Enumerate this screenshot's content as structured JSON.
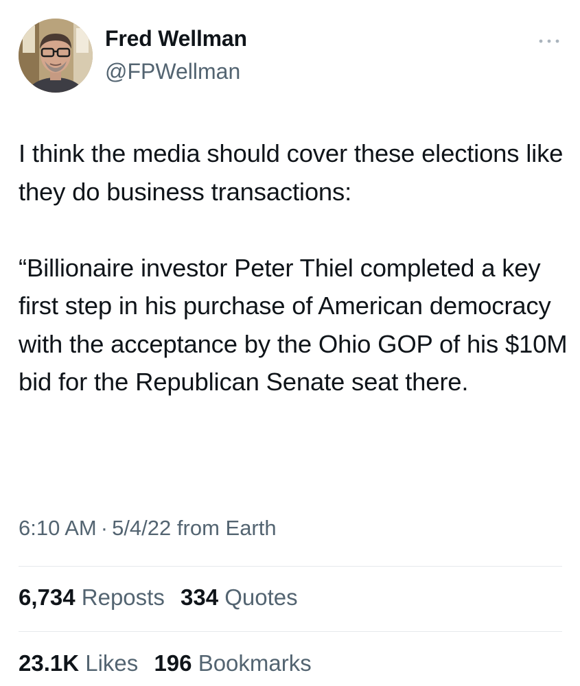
{
  "author": {
    "display_name": "Fred Wellman",
    "handle": "@FPWellman",
    "avatar_icon": "profile-photo"
  },
  "more_icon": "ellipsis-icon",
  "tweet": {
    "paragraph_1": "I think the media should cover these elections like they do business transactions:",
    "paragraph_2": "“Billionaire investor Peter Thiel completed a key first step in his purchase of American democracy with the acceptance by the Ohio GOP of his $10M bid for the Republican Senate seat there."
  },
  "meta": {
    "time": "6:10 AM",
    "separator": "·",
    "date": "5/4/22",
    "source": "from Earth"
  },
  "stats": {
    "reposts": {
      "count": "6,734",
      "label": "Reposts"
    },
    "quotes": {
      "count": "334",
      "label": "Quotes"
    },
    "likes": {
      "count": "23.1K",
      "label": "Likes"
    },
    "bookmarks": {
      "count": "196",
      "label": "Bookmarks"
    }
  },
  "colors": {
    "primary_text": "#0f1419",
    "secondary_text": "#536471",
    "divider": "#e6e9ec",
    "background": "#ffffff"
  }
}
